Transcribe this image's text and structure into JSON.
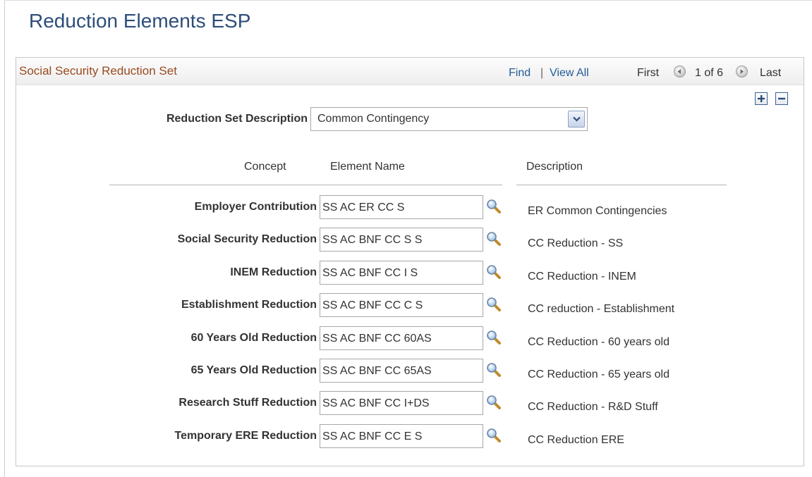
{
  "page": {
    "title": "Reduction Elements ESP"
  },
  "group": {
    "title": "Social Security Reduction Set",
    "find": "Find",
    "separator": "|",
    "view_all": "View All",
    "first": "First",
    "counter": "1 of 6",
    "last": "Last"
  },
  "form": {
    "reduction_set_label": "Reduction Set Description",
    "reduction_set_value": "Common Contingency"
  },
  "columns": {
    "concept": "Concept",
    "element_name": "Element Name",
    "description": "Description"
  },
  "rows": [
    {
      "concept": "Employer Contribution",
      "element": "SS AC ER CC S",
      "description": "ER Common Contingencies"
    },
    {
      "concept": "Social Security Reduction",
      "element": "SS AC BNF CC S S",
      "description": "CC Reduction - SS"
    },
    {
      "concept": "INEM Reduction",
      "element": "SS AC BNF CC I S",
      "description": "CC Reduction - INEM"
    },
    {
      "concept": "Establishment Reduction",
      "element": "SS AC BNF CC C S",
      "description": "CC reduction - Establishment"
    },
    {
      "concept": "60 Years Old Reduction",
      "element": "SS AC BNF CC 60AS",
      "description": "CC Reduction - 60 years old"
    },
    {
      "concept": "65 Years Old Reduction",
      "element": "SS AC BNF CC 65AS",
      "description": "CC Reduction - 65 years old"
    },
    {
      "concept": "Research Stuff Reduction",
      "element": "SS AC BNF CC I+DS",
      "description": "CC Reduction - R&D Stuff"
    },
    {
      "concept": "Temporary ERE Reduction",
      "element": "SS AC BNF CC E S",
      "description": "CC Reduction ERE"
    }
  ],
  "icons": {
    "prev": "arrow-left-icon",
    "next": "arrow-right-icon",
    "add": "plus-icon",
    "delete": "minus-icon",
    "lookup": "magnifier-icon",
    "dropdown": "chevron-down-icon"
  },
  "colors": {
    "title": "#2d4d7a",
    "group_title": "#9b4b1f",
    "link": "#1f5c99"
  }
}
